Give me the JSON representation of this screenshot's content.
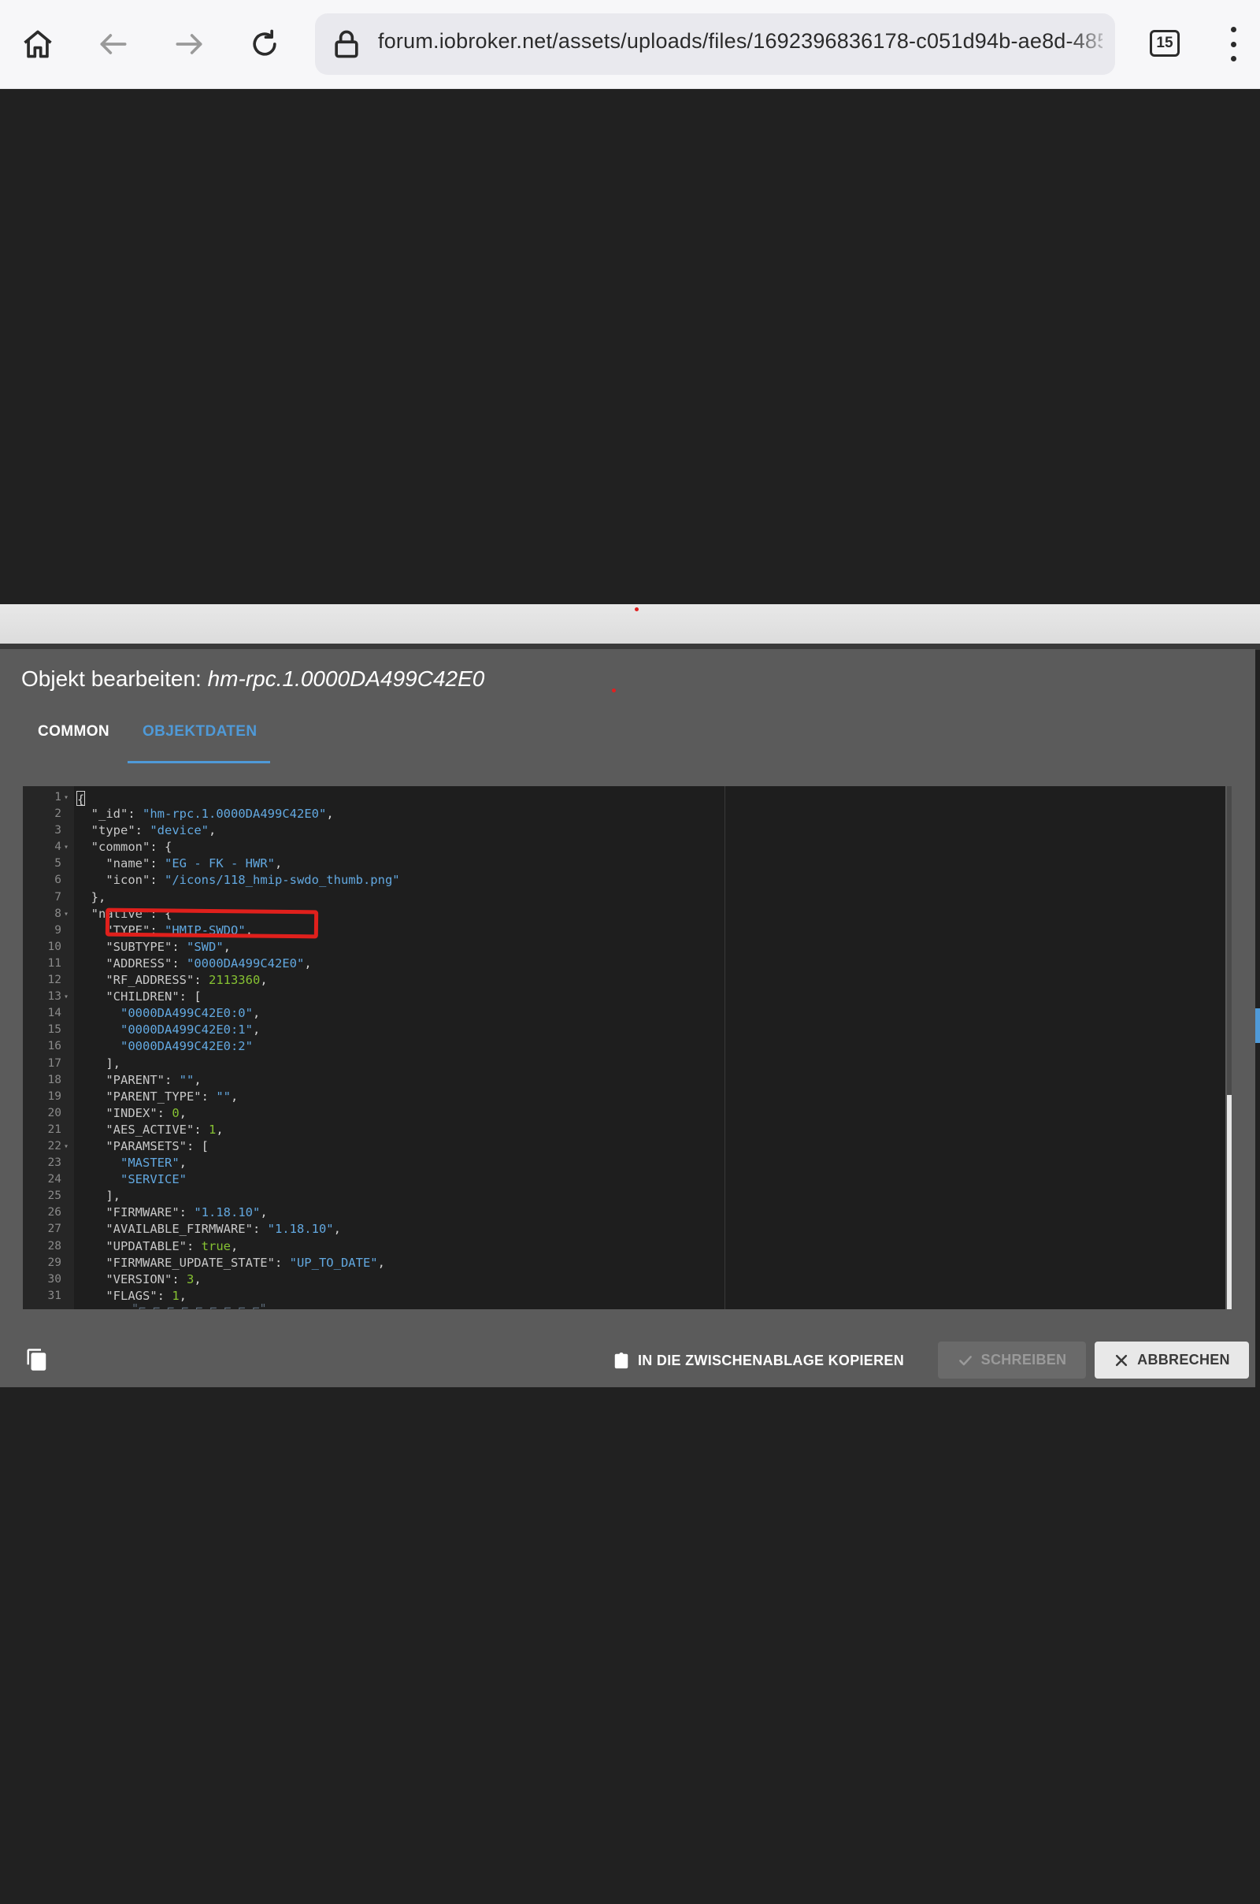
{
  "browser": {
    "url": "forum.iobroker.net/assets/uploads/files/1692396836178-c051d94b-ae8d-485",
    "tab_count": "15",
    "icons": [
      "home-icon",
      "back-icon",
      "forward-icon",
      "reload-icon",
      "lock-icon",
      "tabs-icon",
      "menu-icon"
    ]
  },
  "dialog": {
    "title_prefix": "Objekt bearbeiten: ",
    "object_id": "hm-rpc.1.0000DA499C42E0",
    "tabs": [
      {
        "label": "COMMON",
        "active": false
      },
      {
        "label": "OBJEKTDATEN",
        "active": true
      }
    ],
    "buttons": {
      "copy_clipboard": "IN DIE ZWISCHENABLAGE KOPIEREN",
      "write": "SCHREIBEN",
      "cancel": "ABBRECHEN"
    }
  },
  "editor": {
    "lines": [
      {
        "n": "1",
        "text": "{"
      },
      {
        "n": "2",
        "text": "  \"_id\": \"hm-rpc.1.0000DA499C42E0\","
      },
      {
        "n": "3",
        "text": "  \"type\": \"device\","
      },
      {
        "n": "4",
        "text": "  \"common\": {"
      },
      {
        "n": "5",
        "text": "    \"name\": \"EG - FK - HWR\","
      },
      {
        "n": "6",
        "text": "    \"icon\": \"/icons/118_hmip-swdo_thumb.png\""
      },
      {
        "n": "7",
        "text": "  },"
      },
      {
        "n": "8",
        "text": "  \"native\": {"
      },
      {
        "n": "9",
        "text": "    \"TYPE\": \"HMIP-SWDO\","
      },
      {
        "n": "10",
        "text": "    \"SUBTYPE\": \"SWD\","
      },
      {
        "n": "11",
        "text": "    \"ADDRESS\": \"0000DA499C42E0\","
      },
      {
        "n": "12",
        "text": "    \"RF_ADDRESS\": 2113360,"
      },
      {
        "n": "13",
        "text": "    \"CHILDREN\": ["
      },
      {
        "n": "14",
        "text": "      \"0000DA499C42E0:0\","
      },
      {
        "n": "15",
        "text": "      \"0000DA499C42E0:1\","
      },
      {
        "n": "16",
        "text": "      \"0000DA499C42E0:2\""
      },
      {
        "n": "17",
        "text": "    ],"
      },
      {
        "n": "18",
        "text": "    \"PARENT\": \"\","
      },
      {
        "n": "19",
        "text": "    \"PARENT_TYPE\": \"\","
      },
      {
        "n": "20",
        "text": "    \"INDEX\": 0,"
      },
      {
        "n": "21",
        "text": "    \"AES_ACTIVE\": 1,"
      },
      {
        "n": "22",
        "text": "    \"PARAMSETS\": ["
      },
      {
        "n": "23",
        "text": "      \"MASTER\","
      },
      {
        "n": "24",
        "text": "      \"SERVICE\""
      },
      {
        "n": "25",
        "text": "    ],"
      },
      {
        "n": "26",
        "text": "    \"FIRMWARE\": \"1.18.10\","
      },
      {
        "n": "27",
        "text": "    \"AVAILABLE_FIRMWARE\": \"1.18.10\","
      },
      {
        "n": "28",
        "text": "    \"UPDATABLE\": true,"
      },
      {
        "n": "29",
        "text": "    \"FIRMWARE_UPDATE_STATE\": \"UP_TO_DATE\","
      },
      {
        "n": "30",
        "text": "    \"VERSION\": 3,"
      },
      {
        "n": "31",
        "text": "    \"FLAGS\": 1,"
      }
    ],
    "fold_lines": [
      "1",
      "4",
      "8",
      "13",
      "22"
    ],
    "highlighted_line": "9"
  },
  "colors": {
    "accent": "#4f9ad8",
    "string": "#62a8e0",
    "number": "#86c232",
    "annotation": "#e0201c"
  }
}
